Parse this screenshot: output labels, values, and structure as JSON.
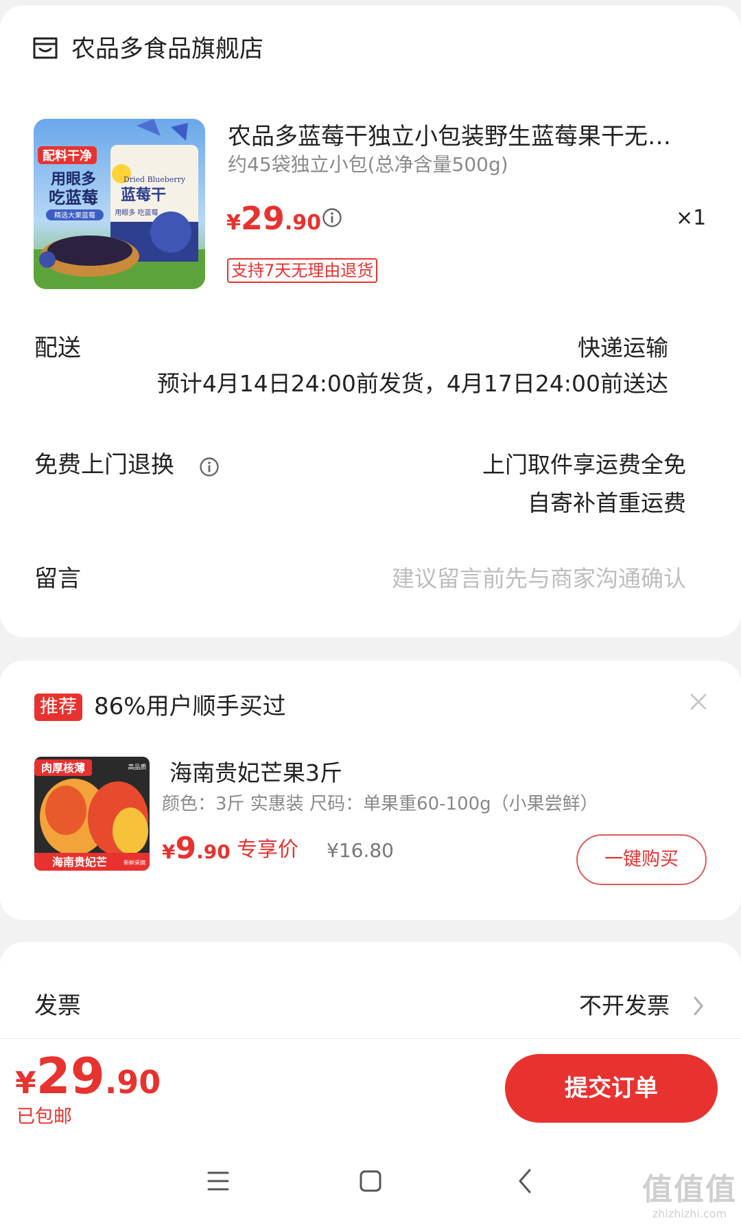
{
  "store": {
    "name": "农品多食品旗舰店",
    "icon": "store-icon"
  },
  "product": {
    "title": "农品多蓝莓干独立小包装野生蓝莓果干无…",
    "spec": "约45袋独立小包(总净含量500g)",
    "price_symbol": "¥",
    "price_int": "29",
    "price_dec": ".90",
    "quantity": "×1",
    "return_tag": "支持7天无理由退货",
    "thumb_text": {
      "badge": "配料干净",
      "line1": "用眼多",
      "line2": "吃蓝莓",
      "sub": "精选大果蓝莓",
      "brand_en": "Dried Blueberry",
      "pack_title": "蓝莓干",
      "pack_sub": "用眼多 吃蓝莓"
    }
  },
  "delivery": {
    "label": "配送",
    "method": "快递运输",
    "estimate": "预计4月14日24:00前发货，4月17日24:00前送达"
  },
  "free_return": {
    "label": "免费上门退换",
    "line1": "上门取件享运费全免",
    "line2": "自寄补首重运费"
  },
  "message": {
    "label": "留言",
    "placeholder": "建议留言前先与商家沟通确认"
  },
  "recommend": {
    "tag": "推荐",
    "title": "86%用户顺手买过",
    "item": {
      "name": "海南贵妃芒果3斤",
      "spec": "颜色：3斤 实惠装   尺码：单果重60-100g（小果尝鲜）",
      "price_symbol": "¥",
      "price_int": "9",
      "price_dec": ".90",
      "exclusive_label": "专享价",
      "original_price": "¥16.80",
      "buy_button": "一键购买",
      "thumb_text": {
        "badge": "肉厚核薄",
        "corner": "高品质",
        "banner": "海南贵妃芒",
        "banner_side": "新鲜采摘"
      }
    }
  },
  "invoice": {
    "label": "发票",
    "value": "不开发票"
  },
  "footer": {
    "price_symbol": "¥",
    "price_int": "29",
    "price_dec": ".90",
    "shipping_note": "已包邮",
    "submit": "提交订单"
  },
  "watermark": {
    "big": "值值值",
    "small": "zhizhizhi.com"
  },
  "colors": {
    "accent": "#e8322f",
    "background": "#f2f2f2"
  }
}
